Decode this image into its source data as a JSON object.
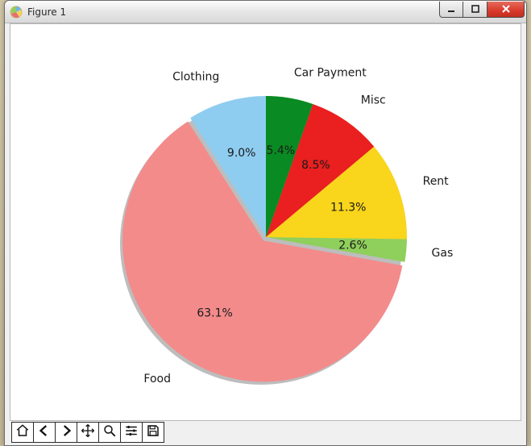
{
  "window": {
    "title": "Figure 1",
    "controls": {
      "minimize": "minimize",
      "maximize": "maximize",
      "close": "close"
    }
  },
  "chart_data": {
    "type": "pie",
    "title": "",
    "series": [
      {
        "name": "Clothing",
        "value": 9.0,
        "percent_label": "9.0%",
        "color": "#8fcdf0"
      },
      {
        "name": "Food",
        "value": 63.1,
        "percent_label": "63.1%",
        "color": "#f38b8b"
      },
      {
        "name": "Gas",
        "value": 2.6,
        "percent_label": "2.6%",
        "color": "#8fcf5b"
      },
      {
        "name": "Rent",
        "value": 11.3,
        "percent_label": "11.3%",
        "color": "#f9d51b"
      },
      {
        "name": "Misc",
        "value": 8.5,
        "percent_label": "8.5%",
        "color": "#ea1f1f"
      },
      {
        "name": "Car Payment",
        "value": 5.4,
        "percent_label": "5.4%",
        "color": "#0a8a22"
      }
    ],
    "start_angle_deg": 90,
    "direction": "counterclockwise",
    "explode": {
      "Food": 0.03
    },
    "shadow": true
  },
  "toolbar": {
    "items": [
      {
        "id": "home",
        "label": "Home"
      },
      {
        "id": "back",
        "label": "Back"
      },
      {
        "id": "forward",
        "label": "Forward"
      },
      {
        "id": "pan",
        "label": "Pan"
      },
      {
        "id": "zoom",
        "label": "Zoom"
      },
      {
        "id": "config",
        "label": "Configure subplots"
      },
      {
        "id": "save",
        "label": "Save"
      }
    ]
  }
}
